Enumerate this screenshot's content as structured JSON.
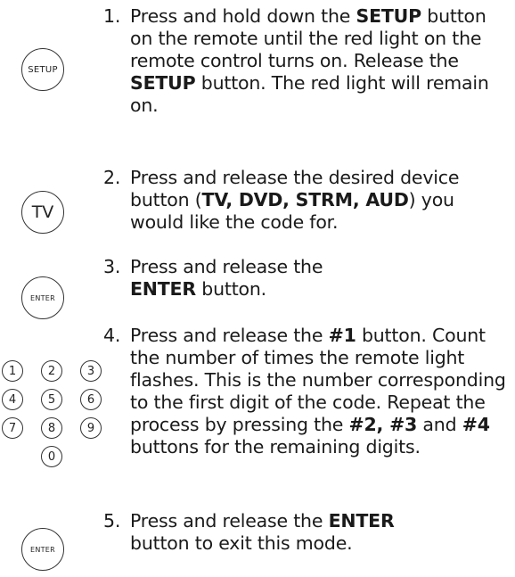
{
  "icons": {
    "setup": "SETUP",
    "tv": "TV",
    "enter_1": "ENTER",
    "numpad": [
      "1",
      "2",
      "3",
      "4",
      "5",
      "6",
      "7",
      "8",
      "9",
      "0"
    ],
    "enter_2": "ENTER"
  },
  "steps": [
    {
      "number": "1.",
      "parts": [
        "Press and hold down the ",
        "SETUP",
        " button on the remote until the red light on the remote control turns on. Release the ",
        "SETUP",
        " button. The red light will remain on."
      ]
    },
    {
      "number": "2.",
      "parts": [
        "Press and release the desired device button (",
        "TV, DVD, STRM, AUD",
        ") you would like the code for."
      ]
    },
    {
      "number": "3.",
      "parts": [
        "Press and release the ",
        "ENTER",
        " button."
      ]
    },
    {
      "number": "4.",
      "parts": [
        "Press and release the ",
        "#1",
        " button. Count the number of times the remote light flashes. This is the number corresponding to the first digit of the code. Repeat the process by pressing the ",
        "#2, #3",
        " and ",
        "#4",
        " buttons for the remaining digits."
      ]
    },
    {
      "number": "5.",
      "parts": [
        "Press and release the ",
        "ENTER",
        " button to exit this mode."
      ]
    }
  ]
}
